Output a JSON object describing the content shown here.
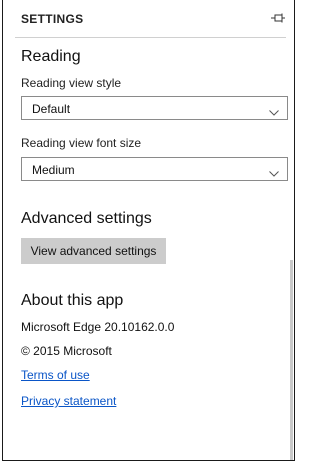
{
  "header": {
    "title": "SETTINGS",
    "pin_icon": "pin-icon"
  },
  "reading": {
    "section_title": "Reading",
    "view_style_label": "Reading view style",
    "view_style_value": "Default",
    "font_size_label": "Reading view font size",
    "font_size_value": "Medium"
  },
  "advanced": {
    "section_title": "Advanced settings",
    "button_label": "View advanced settings"
  },
  "about": {
    "section_title": "About this app",
    "version": "Microsoft Edge 20.10162.0.0",
    "copyright": "© 2015 Microsoft",
    "terms_link": "Terms of use",
    "privacy_link": "Privacy statement"
  },
  "colors": {
    "link": "#0a55c7",
    "button_bg": "#cccccc",
    "border": "#8a8a8a"
  }
}
